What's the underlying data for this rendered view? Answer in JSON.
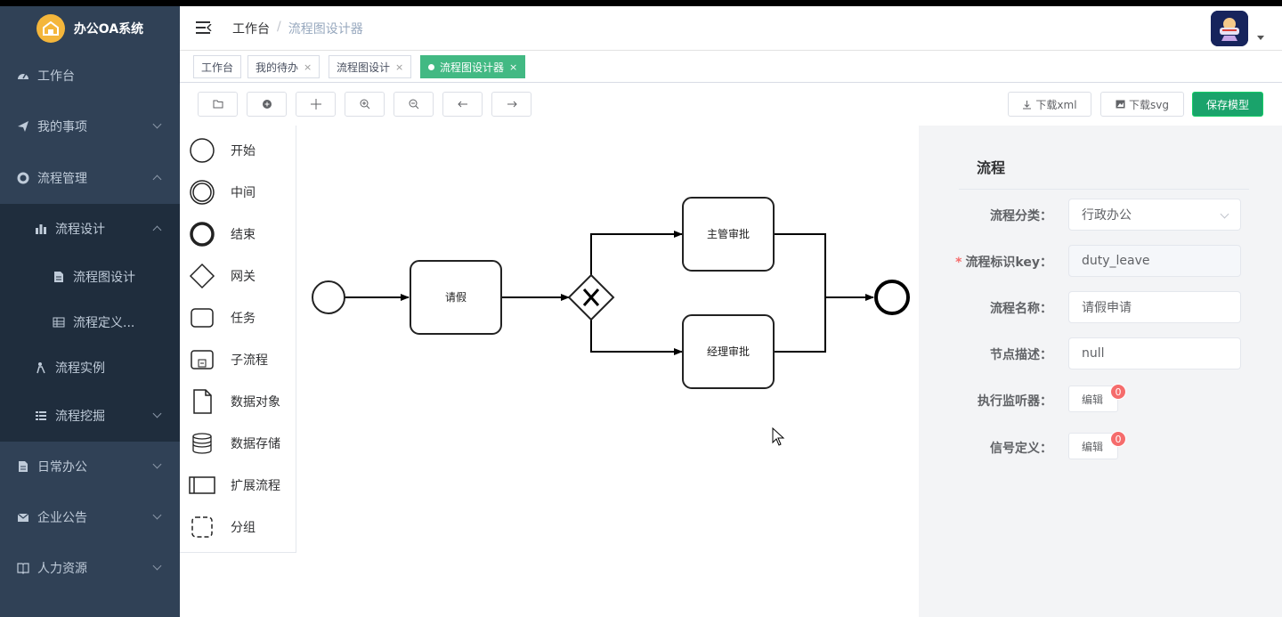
{
  "app": {
    "title": "办公OA系统",
    "brand_color": "#304156",
    "accent_color": "#42b983"
  },
  "sidebar": {
    "items": [
      {
        "label": "工作台",
        "icon": "dashboard-icon"
      },
      {
        "label": "我的事项",
        "icon": "send-icon"
      },
      {
        "label": "流程管理",
        "icon": "settings-icon"
      },
      {
        "label": "流程设计",
        "icon": "bar-chart-icon"
      },
      {
        "label": "流程图设计",
        "icon": "document-icon"
      },
      {
        "label": "流程定义...",
        "icon": "table-icon"
      },
      {
        "label": "流程实例",
        "icon": "person-icon"
      },
      {
        "label": "流程挖掘",
        "icon": "list-icon"
      },
      {
        "label": "日常办公",
        "icon": "document-icon"
      },
      {
        "label": "企业公告",
        "icon": "mail-icon"
      },
      {
        "label": "人力资源",
        "icon": "book-icon"
      }
    ]
  },
  "header": {
    "breadcrumb": [
      "工作台",
      "流程图设计器"
    ],
    "separator": "/"
  },
  "tags": [
    {
      "label": "工作台",
      "close": ""
    },
    {
      "label": "我的待办",
      "close": "×"
    },
    {
      "label": "流程图设计",
      "close": "×"
    },
    {
      "label": "流程图设计器",
      "close": "×"
    }
  ],
  "toolbar": {
    "download_xml": "下载xml",
    "download_svg": "下载svg",
    "save_model": "保存模型"
  },
  "palette": [
    {
      "label": "开始",
      "icon": "start-event-icon"
    },
    {
      "label": "中间",
      "icon": "intermediate-event-icon"
    },
    {
      "label": "结束",
      "icon": "end-event-icon"
    },
    {
      "label": "网关",
      "icon": "gateway-icon"
    },
    {
      "label": "任务",
      "icon": "task-icon"
    },
    {
      "label": "子流程",
      "icon": "subprocess-icon"
    },
    {
      "label": "数据对象",
      "icon": "data-object-icon"
    },
    {
      "label": "数据存储",
      "icon": "data-store-icon"
    },
    {
      "label": "扩展流程",
      "icon": "pool-icon"
    },
    {
      "label": "分组",
      "icon": "group-icon"
    }
  ],
  "diagram": {
    "task_request": "请假",
    "task_supervisor": "主管审批",
    "task_manager": "经理审批"
  },
  "panel": {
    "title": "流程",
    "fields": {
      "category_label": "流程分类：",
      "category_value": "行政办公",
      "key_label": "流程标识key：",
      "key_value": "duty_leave",
      "name_label": "流程名称：",
      "name_value": "请假申请",
      "desc_label": "节点描述：",
      "desc_value": "null",
      "listener_label": "执行监听器：",
      "listener_button": "编辑",
      "listener_count": "0",
      "signal_label": "信号定义：",
      "signal_button": "编辑",
      "signal_count": "0"
    }
  }
}
